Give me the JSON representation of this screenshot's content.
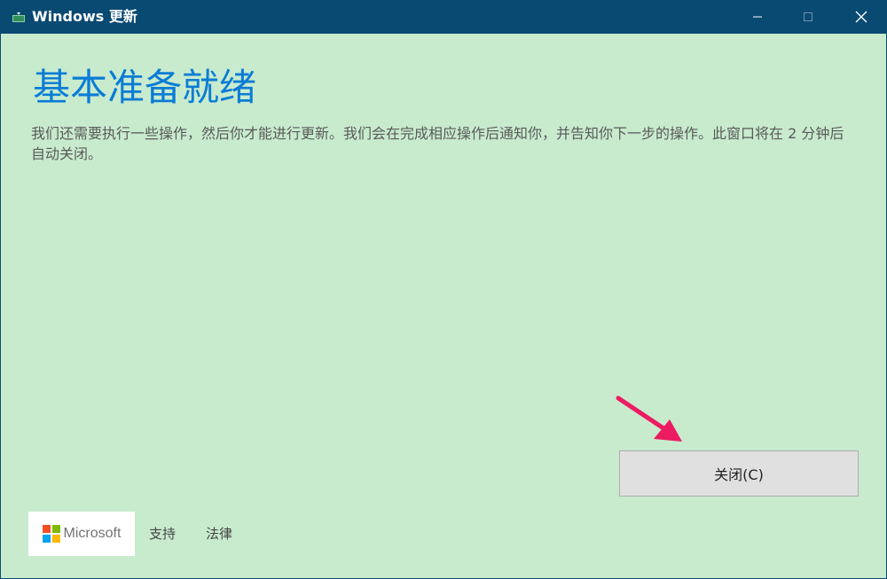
{
  "window": {
    "title": "Windows 更新",
    "controls": {
      "minimize_icon": "minimize-icon",
      "maximize_icon": "maximize-icon",
      "close_icon": "close-icon"
    }
  },
  "main": {
    "heading": "基本准备就绪",
    "description": "我们还需要执行一些操作，然后你才能进行更新。我们会在完成相应操作后通知你，并告知你下一步的操作。此窗口将在 2 分钟后自动关闭。",
    "close_button_label": "关闭(C)"
  },
  "footer": {
    "brand": "Microsoft",
    "links": [
      "支持",
      "法律"
    ]
  },
  "annotation": {
    "arrow_icon": "arrow-icon",
    "color": "#ec1c63"
  },
  "colors": {
    "titlebar": "#094a72",
    "background": "#c8ebce",
    "heading": "#0a7cd5",
    "ms_red": "#f25022",
    "ms_green": "#7fba00",
    "ms_blue": "#00a4ef",
    "ms_yellow": "#ffb900"
  }
}
